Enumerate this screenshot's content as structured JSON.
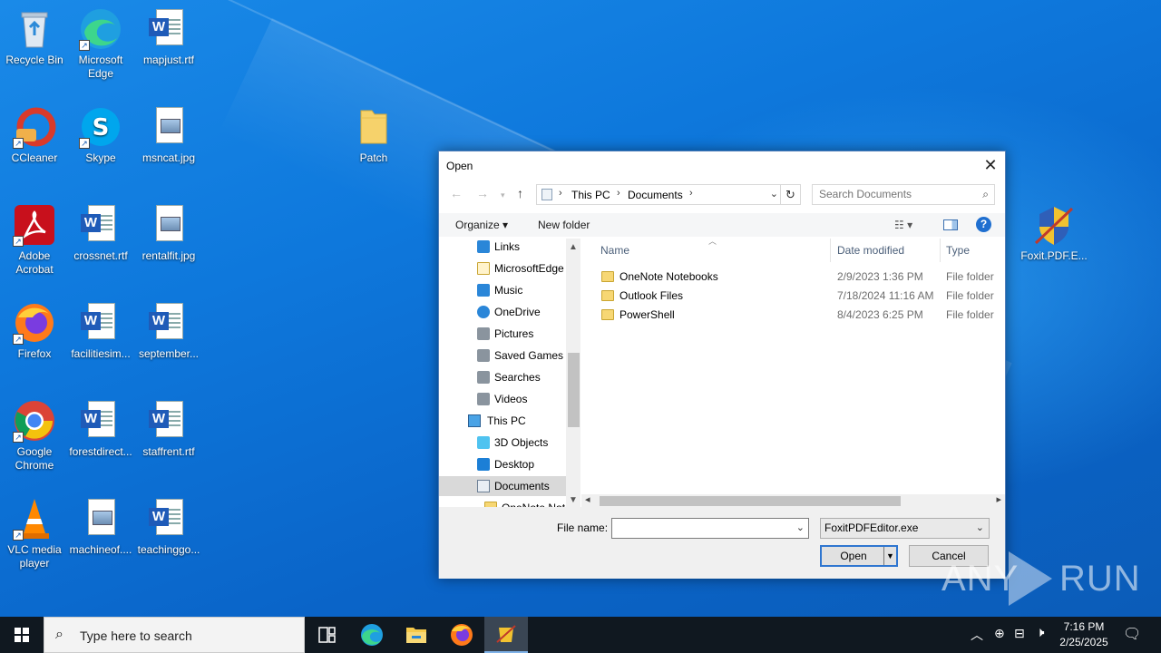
{
  "desktop": {
    "icons": [
      {
        "label": "Recycle Bin"
      },
      {
        "label": "Microsoft Edge"
      },
      {
        "label": "mapjust.rtf"
      },
      {
        "label": "CCleaner"
      },
      {
        "label": "Skype"
      },
      {
        "label": "msncat.jpg"
      },
      {
        "label": "Patch"
      },
      {
        "label": "Adobe Acrobat"
      },
      {
        "label": "crossnet.rtf"
      },
      {
        "label": "rentalfit.jpg"
      },
      {
        "label": "Firefox"
      },
      {
        "label": "facilitiesim..."
      },
      {
        "label": "september..."
      },
      {
        "label": "Google Chrome"
      },
      {
        "label": "forestdirect..."
      },
      {
        "label": "staffrent.rtf"
      },
      {
        "label": "VLC media player"
      },
      {
        "label": "machineof...."
      },
      {
        "label": "teachinggo..."
      },
      {
        "label": "Foxit.PDF.E..."
      }
    ]
  },
  "dialog": {
    "title": "Open",
    "close_glyph": "✕",
    "address": {
      "segments": [
        "This PC",
        "Documents"
      ]
    },
    "search": {
      "placeholder": "Search Documents"
    },
    "toolbar": {
      "organize": "Organize",
      "new_folder": "New folder",
      "help_glyph": "?"
    },
    "tree": [
      {
        "label": "Links"
      },
      {
        "label": "MicrosoftEdge"
      },
      {
        "label": "Music"
      },
      {
        "label": "OneDrive"
      },
      {
        "label": "Pictures"
      },
      {
        "label": "Saved Games"
      },
      {
        "label": "Searches"
      },
      {
        "label": "Videos"
      },
      {
        "label": "This PC"
      },
      {
        "label": "3D Objects"
      },
      {
        "label": "Desktop"
      },
      {
        "label": "Documents"
      },
      {
        "label": "OneNote Not"
      }
    ],
    "columns": {
      "name": "Name",
      "date": "Date modified",
      "type": "Type"
    },
    "files": [
      {
        "name": "OneNote Notebooks",
        "date": "2/9/2023 1:36 PM",
        "type": "File folder"
      },
      {
        "name": "Outlook Files",
        "date": "7/18/2024 11:16 AM",
        "type": "File folder"
      },
      {
        "name": "PowerShell",
        "date": "8/4/2023 6:25 PM",
        "type": "File folder"
      }
    ],
    "filename_label": "File name:",
    "filename_value": "",
    "filetype_value": "FoxitPDFEditor.exe",
    "open_label": "Open",
    "cancel_label": "Cancel"
  },
  "taskbar": {
    "search_placeholder": "Type here to search",
    "time": "7:16 PM",
    "date": "2/25/2025"
  },
  "watermark": {
    "left": "ANY",
    "right": "RUN"
  },
  "colors": {
    "desktop": "#0e78dc",
    "taskbar": "#101820",
    "accent": "#2f76d0"
  }
}
